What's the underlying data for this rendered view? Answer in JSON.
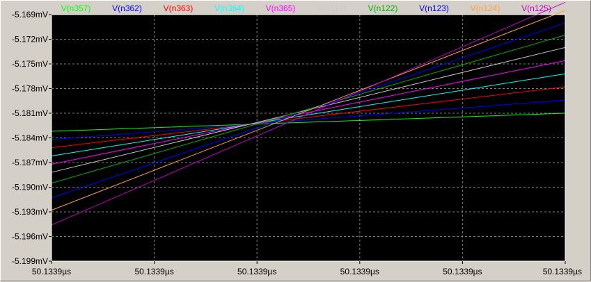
{
  "chart_data": {
    "type": "line",
    "title": "",
    "xlabel": "",
    "ylabel": "",
    "x_ticks": [
      "50.1339µs",
      "50.1339µs",
      "50.1339µs",
      "50.1339µs",
      "50.1339µs",
      "50.1339µs"
    ],
    "y_ticks": [
      "-5.169mV",
      "-5.172mV",
      "-5.175mV",
      "-5.178mV",
      "-5.181mV",
      "-5.184mV",
      "-5.187mV",
      "-5.190mV",
      "-5.193mV",
      "-5.196mV",
      "-5.199mV"
    ],
    "ylim": [
      -5.199,
      -5.169
    ],
    "xlim": [
      0,
      1
    ],
    "grid": true,
    "legend": "top",
    "colors": {
      "background": "#000000",
      "grid": "#808080",
      "frame": "#ffffff",
      "tick_text": "#000000"
    },
    "series": [
      {
        "name": "V(n357)",
        "color": "#00ff00",
        "x": [
          0,
          1
        ],
        "y": [
          -5.1832,
          -5.181
        ]
      },
      {
        "name": "V(n362)",
        "color": "#0000ff",
        "x": [
          0,
          1
        ],
        "y": [
          -5.1842,
          -5.1794
        ]
      },
      {
        "name": "V(n363)",
        "color": "#ff0000",
        "x": [
          0,
          1
        ],
        "y": [
          -5.1852,
          -5.1778
        ]
      },
      {
        "name": "V(n364)",
        "color": "#00ffff",
        "x": [
          0,
          1
        ],
        "y": [
          -5.1862,
          -5.1762
        ]
      },
      {
        "name": "V(n365)",
        "color": "#ff00ff",
        "x": [
          0,
          1
        ],
        "y": [
          -5.1872,
          -5.1746
        ]
      },
      {
        "name": "V(n117)",
        "color": "#c8c8c8",
        "x": [
          0,
          1
        ],
        "y": [
          -5.1882,
          -5.173
        ]
      },
      {
        "name": "V(n122)",
        "color": "#00b000",
        "x": [
          0,
          1
        ],
        "y": [
          -5.1895,
          -5.1715
        ]
      },
      {
        "name": "V(n123)",
        "color": "#0000ff",
        "x": [
          0,
          1
        ],
        "y": [
          -5.1913,
          -5.17
        ]
      },
      {
        "name": "V(n124)",
        "color": "#ffa040",
        "x": [
          0,
          1
        ],
        "y": [
          -5.1928,
          -5.1685
        ]
      },
      {
        "name": "V(n125)",
        "color": "#c000c0",
        "x": [
          0,
          1
        ],
        "y": [
          -5.1946,
          -5.1675
        ]
      }
    ]
  }
}
